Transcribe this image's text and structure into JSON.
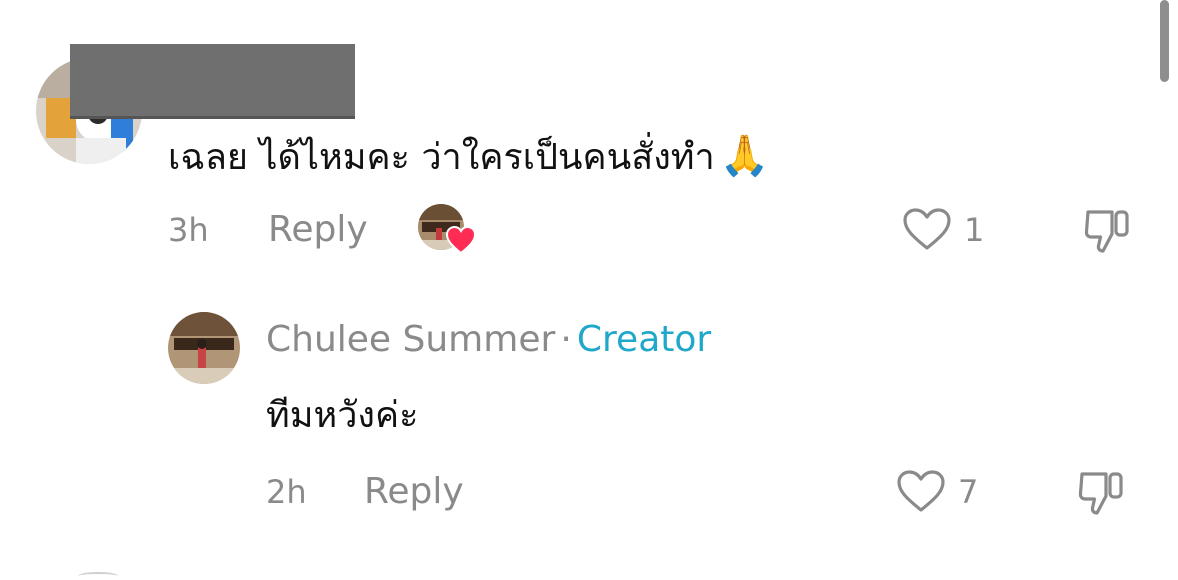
{
  "comments": [
    {
      "text": "เฉลย ได้ไหมคะ ว่าใครเป็นคนสั่งทำ",
      "emoji": "🙏",
      "time": "3h",
      "reply_label": "Reply",
      "like_count": "1",
      "liked_by_creator": true
    }
  ],
  "reply": {
    "author": "Chulee Summer",
    "separator": "·",
    "badge": "Creator",
    "text": "ทีมหวังค่ะ",
    "time": "2h",
    "reply_label": "Reply",
    "like_count": "7"
  },
  "colors": {
    "creator_badge": "#1fa8c9",
    "heart_badge": "#fe2c55",
    "meta_text": "#8a8a8a"
  },
  "icons": [
    "heart-outline-icon",
    "dislike-icon",
    "heart-badge-icon"
  ]
}
